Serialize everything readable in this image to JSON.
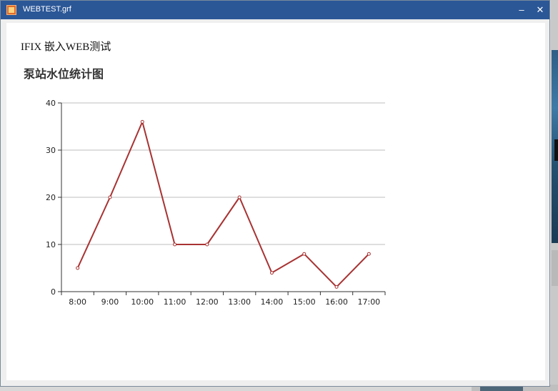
{
  "window": {
    "title": "WEBTEST.grf",
    "minimize_glyph": "–",
    "close_glyph": "✕"
  },
  "page": {
    "heading": "IFIX 嵌入WEB测试"
  },
  "colors": {
    "titlebar": "#2b5797",
    "series": "#a83232",
    "grid": "#bdbdbd"
  },
  "chart_data": {
    "type": "line",
    "title": "泵站水位统计图",
    "categories": [
      "8:00",
      "9:00",
      "10:00",
      "11:00",
      "12:00",
      "13:00",
      "14:00",
      "15:00",
      "16:00",
      "17:00"
    ],
    "values": [
      5,
      20,
      36,
      10,
      10,
      20,
      4,
      8,
      1,
      8
    ],
    "ylim": [
      0,
      40
    ],
    "yticks": [
      0,
      10,
      20,
      30,
      40
    ],
    "grid": true,
    "legend": false
  }
}
